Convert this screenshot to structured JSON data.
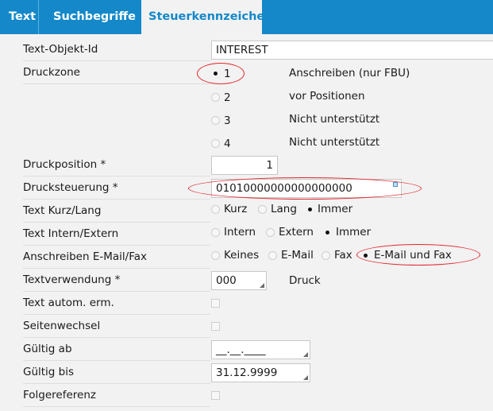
{
  "tabs": [
    "Text",
    "Suchbegriffe",
    "Steuerkennzeichen"
  ],
  "labels": {
    "text_objekt_id": "Text-Objekt-Id",
    "druckzone": "Druckzone",
    "druckposition": "Druckposition *",
    "drucksteuerung": "Drucksteuerung *",
    "text_kurz_lang": "Text Kurz/Lang",
    "text_intern_extern": "Text Intern/Extern",
    "anschreiben_email_fax": "Anschreiben E-Mail/Fax",
    "textverwendung": "Textverwendung *",
    "text_autom_erm": "Text autom. erm.",
    "seitenwechsel": "Seitenwechsel",
    "gueltig_ab": "Gültig ab",
    "gueltig_bis": "Gültig bis",
    "folgereferenz": "Folgereferenz"
  },
  "values": {
    "text_objekt_id": "INTEREST",
    "druckposition": "1",
    "drucksteuerung": "01010000000000000000",
    "textverwendung": "000",
    "textverwendung_desc": "Druck",
    "gueltig_ab": "__.__.____",
    "gueltig_bis": "31.12.9999"
  },
  "druckzone_options": [
    {
      "value": "1",
      "desc": "Anschreiben (nur FBU)",
      "selected": true
    },
    {
      "value": "2",
      "desc": "vor Positionen",
      "selected": false
    },
    {
      "value": "3",
      "desc": "Nicht unterstützt",
      "selected": false
    },
    {
      "value": "4",
      "desc": "Nicht unterstützt",
      "selected": false
    }
  ],
  "text_kurz_lang_options": [
    {
      "label": "Kurz",
      "selected": false
    },
    {
      "label": "Lang",
      "selected": false
    },
    {
      "label": "Immer",
      "selected": true
    }
  ],
  "text_intern_extern_options": [
    {
      "label": "Intern",
      "selected": false
    },
    {
      "label": "Extern",
      "selected": false
    },
    {
      "label": "Immer",
      "selected": true
    }
  ],
  "anschreiben_options": [
    {
      "label": "Keines",
      "selected": false
    },
    {
      "label": "E-Mail",
      "selected": false
    },
    {
      "label": "Fax",
      "selected": false
    },
    {
      "label": "E-Mail und Fax",
      "selected": true
    }
  ],
  "checkboxes": {
    "text_autom_erm": false,
    "seitenwechsel": false,
    "folgereferenz": false
  },
  "colors": {
    "tab_bar": "#1488c9",
    "annotation": "#e3262c",
    "background": "#f2f2f2"
  }
}
